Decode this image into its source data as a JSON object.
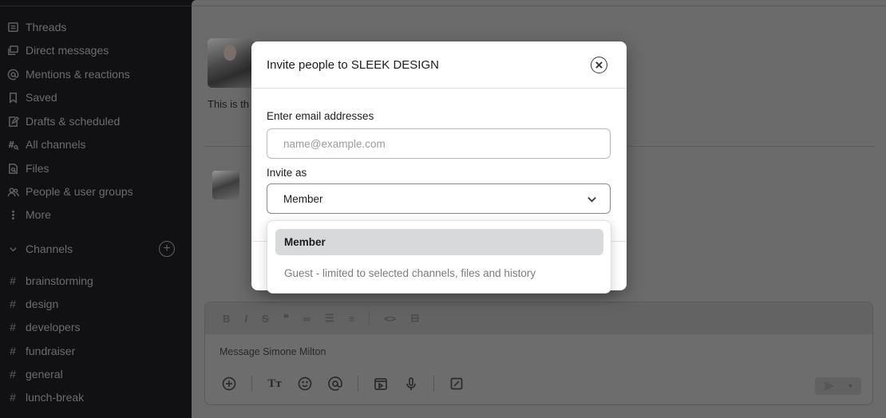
{
  "sidebar": {
    "nav": [
      {
        "label": "Threads",
        "icon": "threads-icon"
      },
      {
        "label": "Direct messages",
        "icon": "direct-messages-icon"
      },
      {
        "label": "Mentions & reactions",
        "icon": "at-icon"
      },
      {
        "label": "Saved",
        "icon": "bookmark-icon"
      },
      {
        "label": "Drafts & scheduled",
        "icon": "drafts-icon"
      },
      {
        "label": "All channels",
        "icon": "channels-search-icon"
      },
      {
        "label": "Files",
        "icon": "files-icon"
      },
      {
        "label": "People & user groups",
        "icon": "people-icon"
      },
      {
        "label": "More",
        "icon": "more-vertical-icon"
      }
    ],
    "channels_header": "Channels",
    "channels": [
      "brainstorming",
      "design",
      "developers",
      "fundraiser",
      "general",
      "lunch-break"
    ]
  },
  "main": {
    "message_text": "This is th",
    "composer": {
      "placeholder": "Message Simone Milton"
    }
  },
  "modal": {
    "title": "Invite people to SLEEK DESIGN",
    "email_label": "Enter email addresses",
    "email_placeholder": "name@example.com",
    "invite_as_label": "Invite as",
    "selected_role": "Member",
    "options": [
      {
        "label": "Member",
        "selected": true
      },
      {
        "label": "Guest - limited to selected channels, files and history",
        "selected": false
      }
    ]
  },
  "colors": {
    "sidebar_bg": "#111113",
    "main_overlay": "#6b6b6b",
    "modal_bg": "#ffffff",
    "selected_option_bg": "#d8d9db"
  }
}
